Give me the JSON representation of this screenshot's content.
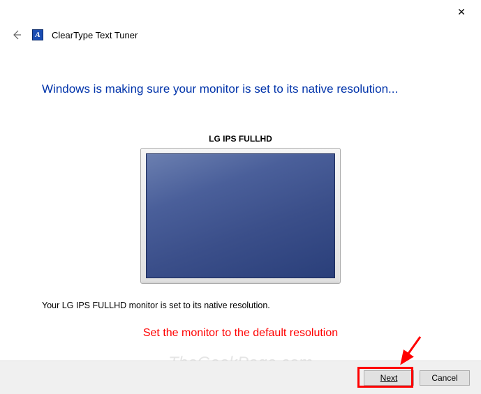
{
  "titlebar": {
    "close_symbol": "✕"
  },
  "header": {
    "app_title": "ClearType Text Tuner"
  },
  "content": {
    "heading": "Windows is making sure your monitor is set to its native resolution...",
    "monitor_name": "LG IPS FULLHD",
    "status_text": "Your LG IPS FULLHD monitor is set to its native resolution."
  },
  "annotation": {
    "text": "Set the monitor to the default resolution"
  },
  "footer": {
    "next_label": "Next",
    "cancel_label": "Cancel"
  },
  "watermark": "TheGeekPage.com"
}
